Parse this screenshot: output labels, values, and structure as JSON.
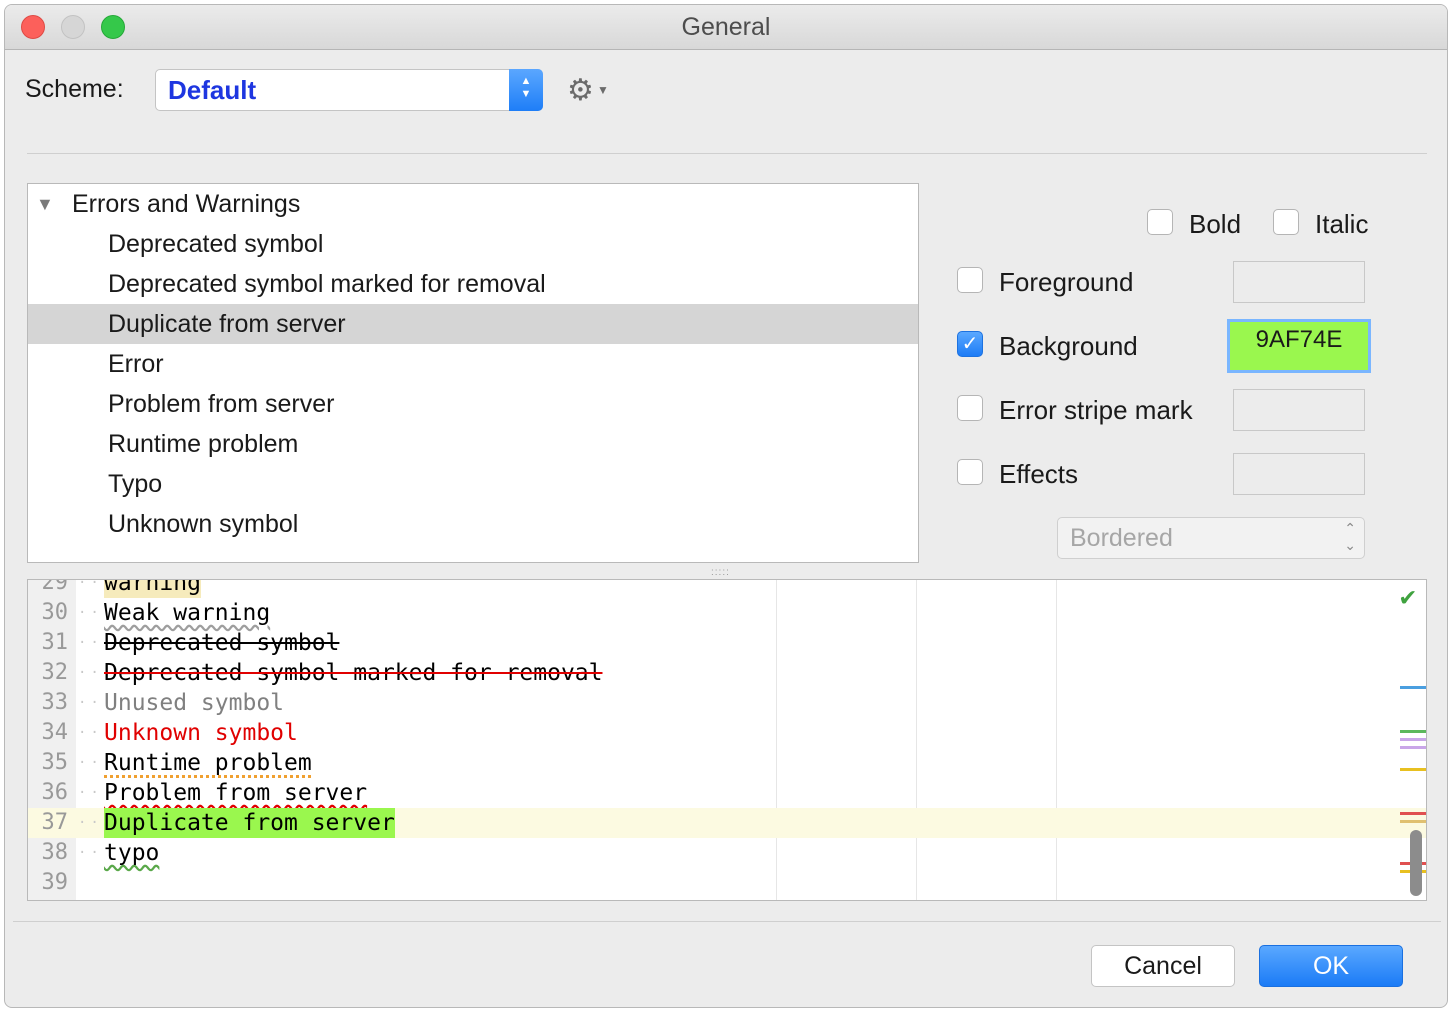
{
  "window": {
    "title": "General"
  },
  "scheme": {
    "label": "Scheme:",
    "value": "Default"
  },
  "tree": {
    "group": "Errors and Warnings",
    "items": [
      "Deprecated symbol",
      "Deprecated symbol marked for removal",
      "Duplicate from server",
      "Error",
      "Problem from server",
      "Runtime problem",
      "Typo",
      "Unknown symbol"
    ],
    "selected_index": 2
  },
  "options": {
    "bold": "Bold",
    "italic": "Italic",
    "foreground": "Foreground",
    "background": "Background",
    "background_value": "9AF74E",
    "error_stripe": "Error stripe mark",
    "effects": "Effects",
    "effect_type": "Bordered"
  },
  "editor": {
    "lines": [
      {
        "n": "29",
        "text": "warning"
      },
      {
        "n": "30",
        "text": "Weak warning"
      },
      {
        "n": "31",
        "text": "Deprecated symbol"
      },
      {
        "n": "32",
        "text": "Deprecated symbol marked for removal"
      },
      {
        "n": "33",
        "text": "Unused symbol"
      },
      {
        "n": "34",
        "text": "Unknown symbol"
      },
      {
        "n": "35",
        "text": "Runtime problem"
      },
      {
        "n": "36",
        "text": "Problem from server"
      },
      {
        "n": "37",
        "text": "Duplicate from server"
      },
      {
        "n": "38",
        "text": "typo"
      },
      {
        "n": "39",
        "text": ""
      }
    ]
  },
  "buttons": {
    "cancel": "Cancel",
    "ok": "OK"
  },
  "colors": {
    "accent": "#1e7ef7",
    "duplicate_bg": "#9af74e"
  }
}
